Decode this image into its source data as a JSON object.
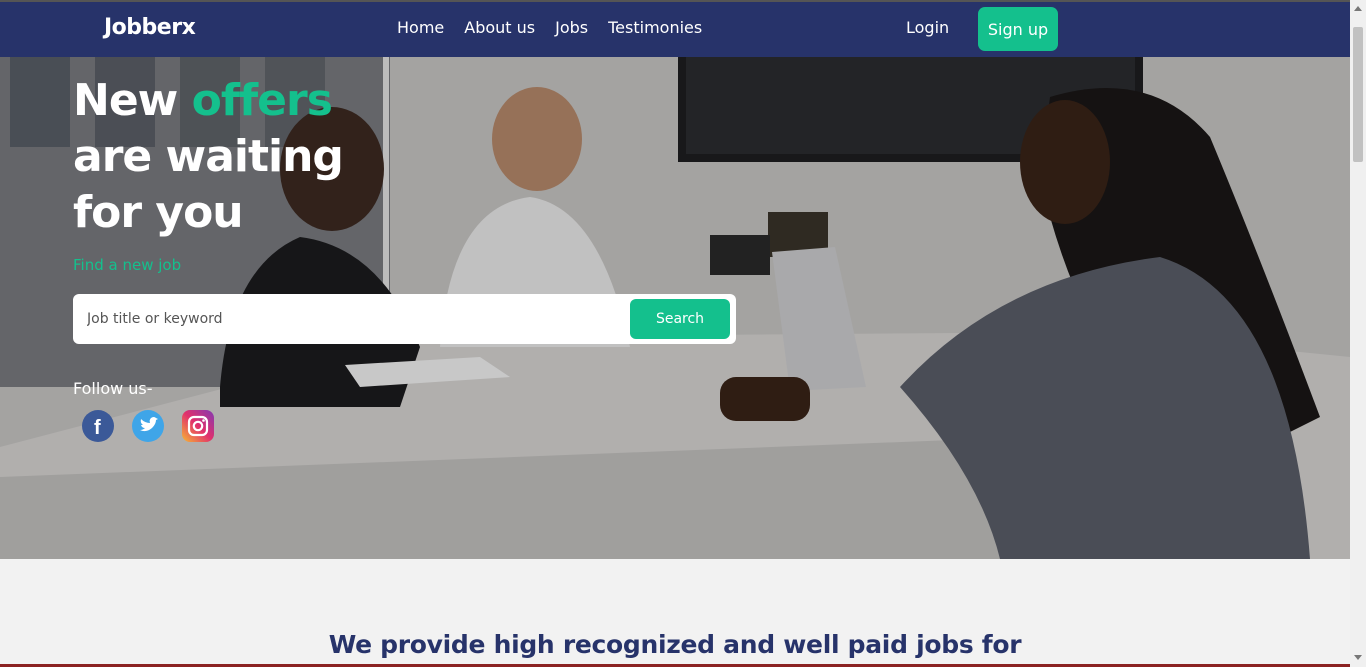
{
  "nav": {
    "brand": "Jobberx",
    "links": [
      "Home",
      "About us",
      "Jobs",
      "Testimonies"
    ],
    "login": "Login",
    "signup": "Sign up"
  },
  "hero": {
    "headline_word1": "New",
    "headline_accent": "offers",
    "headline_line2": "are waiting",
    "headline_line3": "for you",
    "subline": "Find a new job",
    "search": {
      "placeholder": "Job title or keyword",
      "value": "",
      "button": "Search"
    },
    "follow_label": "Follow us-",
    "socials": [
      "facebook-icon",
      "twitter-icon",
      "instagram-icon"
    ]
  },
  "section": {
    "title": "We provide high recognized and well paid jobs for"
  },
  "colors": {
    "navbar": "#27336a",
    "accent": "#14c08d",
    "background": "#f2f2f2"
  }
}
